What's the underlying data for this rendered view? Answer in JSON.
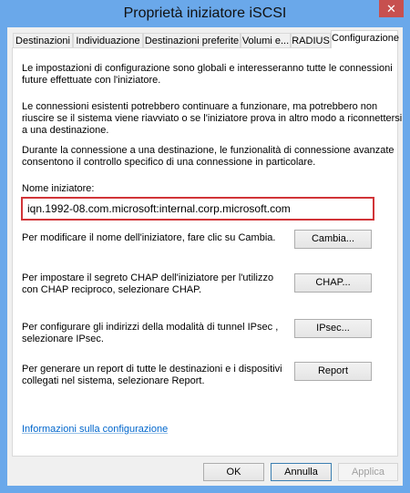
{
  "window": {
    "title": "Proprietà iniziatore iSCSI",
    "close_icon": "close-icon"
  },
  "tabs": [
    {
      "label": "Destinazioni"
    },
    {
      "label": "Individuazione"
    },
    {
      "label": "Destinazioni preferite"
    },
    {
      "label": "Volumi e..."
    },
    {
      "label": "RADIUS"
    },
    {
      "label": "Configurazione",
      "active": true
    }
  ],
  "config": {
    "para1": [
      "Le impostazioni di configurazione sono globali e interesseranno tutte le connessioni",
      "future effettuate con l'iniziatore."
    ],
    "para2": [
      "Le connessioni esistenti potrebbero continuare a funzionare, ma potrebbero non",
      "riuscire se il sistema viene riavviato o se l'iniziatore prova in altro modo a riconnettersi",
      "a una destinazione."
    ],
    "para3": [
      "Durante la connessione a una destinazione, le funzionalità di connessione avanzate",
      "consentono il controllo specifico di una connessione in particolare."
    ],
    "name_label": "Nome iniziatore:",
    "name_value": "iqn.1992-08.com.microsoft:internal.corp.microsoft.com",
    "change_text": "Per modificare il nome dell'iniziatore, fare clic su Cambia.",
    "change_button": "Cambia...",
    "chap_text": [
      "Per impostare il segreto CHAP dell'iniziatore per l'utilizzo",
      "con CHAP reciproco, selezionare CHAP."
    ],
    "chap_button": "CHAP...",
    "ipsec_text": [
      "Per configurare gli indirizzi della modalità di tunnel IPsec ,",
      "selezionare IPsec."
    ],
    "ipsec_button": "IPsec...",
    "report_text": [
      "Per generare un report di tutte le destinazioni e i dispositivi",
      "collegati nel sistema, selezionare Report."
    ],
    "report_button": "Report",
    "info_link": "Informazioni sulla configurazione"
  },
  "footer": {
    "ok": "OK",
    "cancel": "Annulla",
    "apply": "Applica"
  }
}
